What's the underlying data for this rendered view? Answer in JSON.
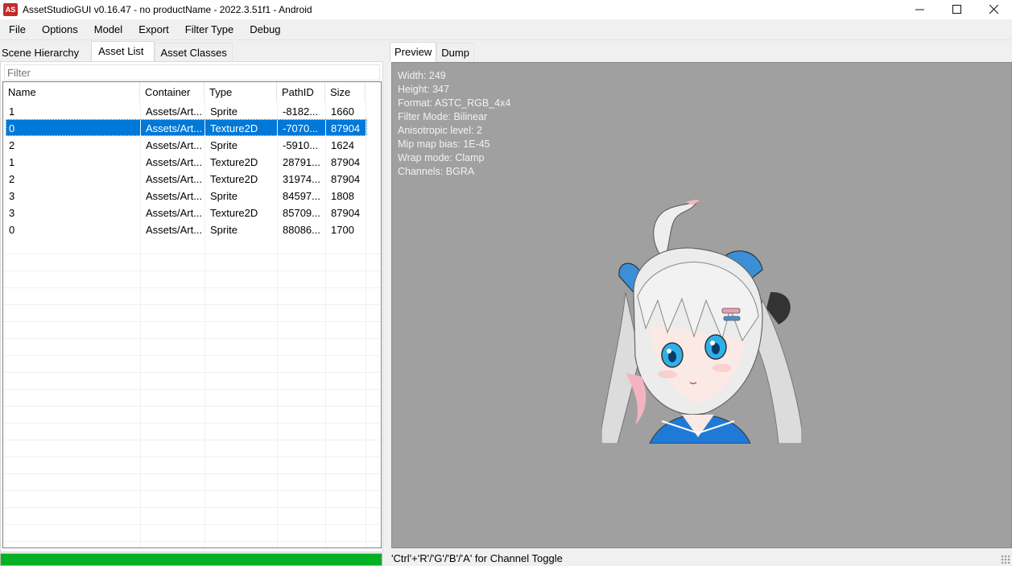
{
  "window": {
    "title": "AssetStudioGUI v0.16.47 - no productName - 2022.3.51f1 - Android",
    "app_icon_text": "AS",
    "controls": [
      "minimize-icon",
      "maximize-icon",
      "close-icon"
    ]
  },
  "menu": [
    "File",
    "Options",
    "Model",
    "Export",
    "Filter Type",
    "Debug"
  ],
  "left_tabs": [
    {
      "label": "Scene Hierarchy",
      "active": false
    },
    {
      "label": "Asset List",
      "active": true
    },
    {
      "label": "Asset Classes",
      "active": false
    }
  ],
  "filter": {
    "placeholder": "Filter",
    "value": ""
  },
  "table": {
    "columns": [
      "Name",
      "Container",
      "Type",
      "PathID",
      "Size"
    ],
    "rows": [
      {
        "name": "1",
        "container": "Assets/Art...",
        "type": "Sprite",
        "pathid": "-8182...",
        "size": "1660",
        "selected": false
      },
      {
        "name": "0",
        "container": "Assets/Art...",
        "type": "Texture2D",
        "pathid": "-7070...",
        "size": "87904",
        "selected": true
      },
      {
        "name": "2",
        "container": "Assets/Art...",
        "type": "Sprite",
        "pathid": "-5910...",
        "size": "1624",
        "selected": false
      },
      {
        "name": "1",
        "container": "Assets/Art...",
        "type": "Texture2D",
        "pathid": "28791...",
        "size": "87904",
        "selected": false
      },
      {
        "name": "2",
        "container": "Assets/Art...",
        "type": "Texture2D",
        "pathid": "31974...",
        "size": "87904",
        "selected": false
      },
      {
        "name": "3",
        "container": "Assets/Art...",
        "type": "Sprite",
        "pathid": "84597...",
        "size": "1808",
        "selected": false
      },
      {
        "name": "3",
        "container": "Assets/Art...",
        "type": "Texture2D",
        "pathid": "85709...",
        "size": "87904",
        "selected": false
      },
      {
        "name": "0",
        "container": "Assets/Art...",
        "type": "Sprite",
        "pathid": "88086...",
        "size": "1700",
        "selected": false
      }
    ]
  },
  "progress": {
    "value": 1.0,
    "color": "#06b025"
  },
  "right_tabs": [
    {
      "label": "Preview",
      "active": true
    },
    {
      "label": "Dump",
      "active": false
    }
  ],
  "preview": {
    "info_lines": [
      "Width: 249",
      "Height: 347",
      "Format: ASTC_RGB_4x4",
      "Filter Mode: Bilinear",
      "Anisotropic level: 2",
      "Mip map bias: 1E-45",
      "Wrap mode: Clamp",
      "Channels: BGRA"
    ],
    "image_icon": "anime-girl-texture-image",
    "background": "#a0a0a0"
  },
  "status": "'Ctrl'+'R'/'G'/'B'/'A' for Channel Toggle",
  "colors": {
    "selection": "#0078d7",
    "progress": "#06b025",
    "app_icon": "#c42b2b"
  }
}
